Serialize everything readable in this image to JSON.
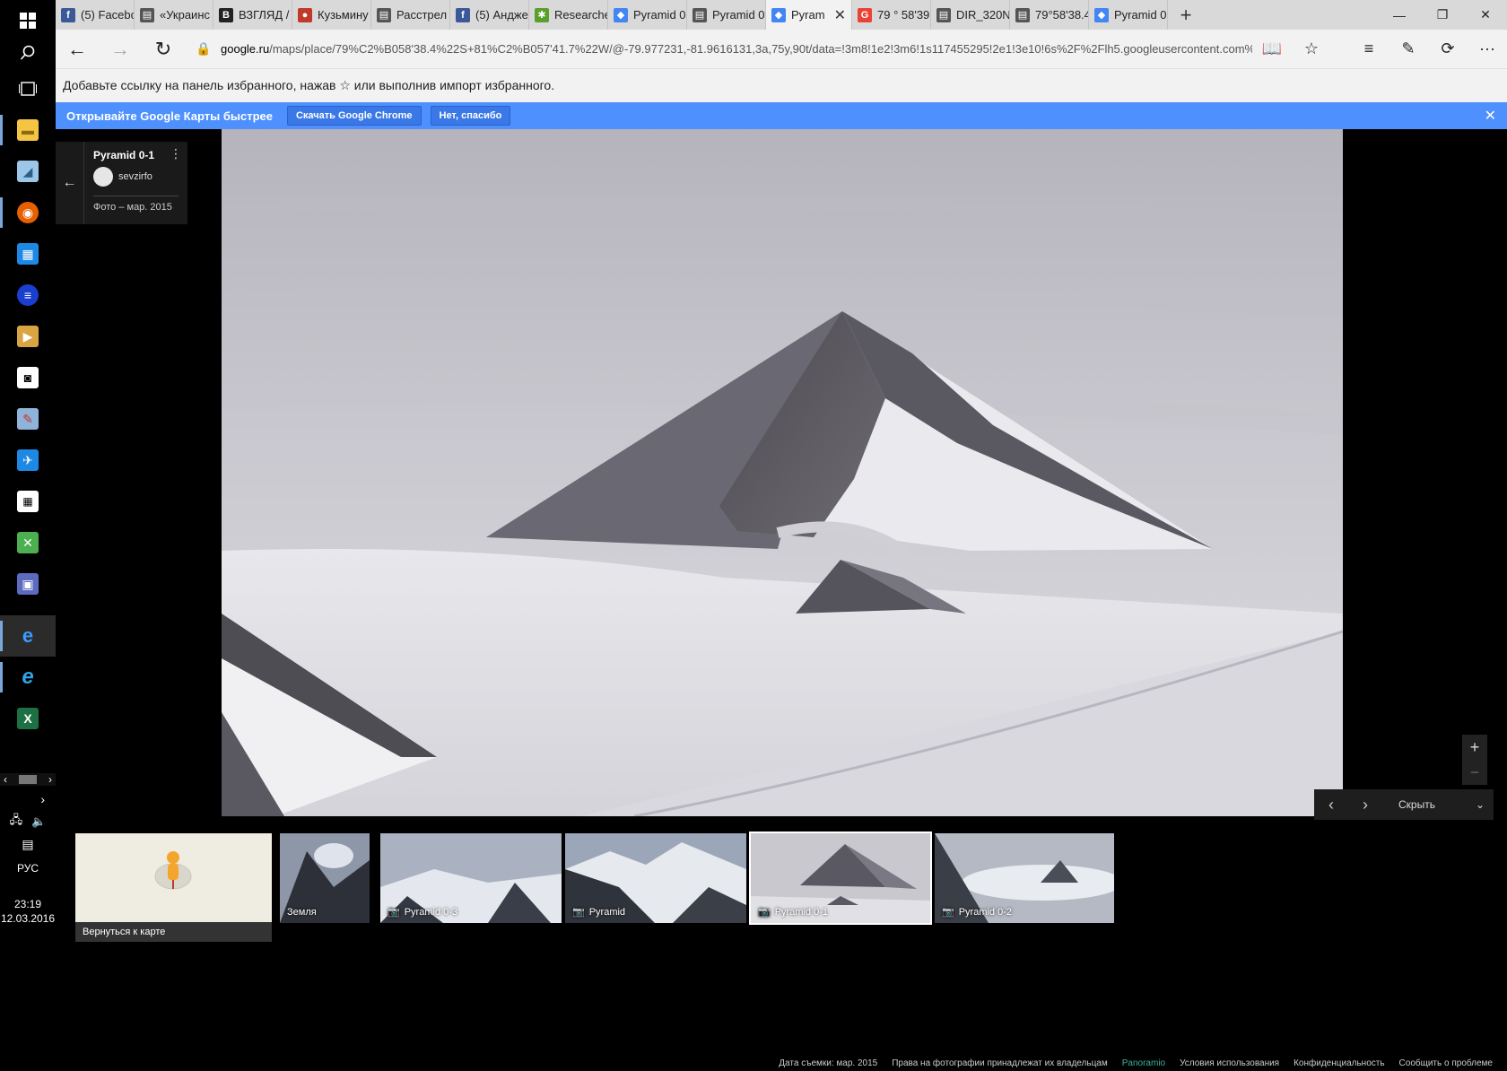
{
  "taskbar": {
    "lang": "РУС",
    "time": "23:19",
    "date": "12.03.2016"
  },
  "tabs": [
    {
      "label": "(5) Facebo",
      "icon": "facebook-icon",
      "color": "#3b5998",
      "glyph": "f"
    },
    {
      "label": "«Украинс",
      "icon": "page-icon",
      "color": "#555555",
      "glyph": "▤"
    },
    {
      "label": "ВЗГЛЯД /",
      "icon": "vzglyad-icon",
      "color": "#222222",
      "glyph": "B"
    },
    {
      "label": "Кузьмину",
      "icon": "site-icon",
      "color": "#c0392b",
      "glyph": "●"
    },
    {
      "label": "Расстрел ц",
      "icon": "page-icon",
      "color": "#555555",
      "glyph": "▤"
    },
    {
      "label": "(5) Андже",
      "icon": "facebook-icon",
      "color": "#3b5998",
      "glyph": "f"
    },
    {
      "label": "Researche",
      "icon": "research-icon",
      "color": "#5aa02c",
      "glyph": "✱"
    },
    {
      "label": "Pyramid 0",
      "icon": "maps-icon",
      "color": "#4285f4",
      "glyph": "◆"
    },
    {
      "label": "Pyramid 0-",
      "icon": "page-icon",
      "color": "#555555",
      "glyph": "▤"
    },
    {
      "label": "Pyram",
      "icon": "maps-icon",
      "color": "#4285f4",
      "glyph": "◆",
      "active": true
    },
    {
      "label": "79 ° 58'39",
      "icon": "google-icon",
      "color": "#ea4335",
      "glyph": "G"
    },
    {
      "label": "DIR_320NF",
      "icon": "page-icon",
      "color": "#555555",
      "glyph": "▤"
    },
    {
      "label": "79°58'38.4",
      "icon": "page-icon",
      "color": "#555555",
      "glyph": "▤"
    },
    {
      "label": "Pyramid 0-",
      "icon": "maps-icon",
      "color": "#4285f4",
      "glyph": "◆"
    }
  ],
  "address": {
    "domain": "google.ru",
    "path": "/maps/place/79%C2%B058'38.4%22S+81%C2%B057'41.7%22W/@-79.977231,-81.9616131,3a,75y,90t/data=!3m8!1e2!3m6!1s117455295!2e1!3e10!6s%2F%2Flh5.googleusercontent.com%2F"
  },
  "favorites_hint": "Добавьте ссылку на панель избранного, нажав ☆ или выполнив импорт избранного.",
  "promo": {
    "text": "Открывайте Google Карты быстрее",
    "download": "Скачать Google Chrome",
    "decline": "Нет, спасибо"
  },
  "photo_info": {
    "title": "Pyramid 0-1",
    "user": "sevzirfo",
    "date": "Фото – мар. 2015"
  },
  "strip": {
    "hide": "Скрыть"
  },
  "filmstrip": {
    "back_to_map": "Вернуться к карте",
    "items": [
      {
        "label": "Земля",
        "camera": false
      },
      {
        "label": "Pyramid 0-3",
        "camera": true
      },
      {
        "label": "Pyramid",
        "camera": true
      },
      {
        "label": "Pyramid 0-1",
        "camera": true,
        "selected": true
      },
      {
        "label": "Pyramid 0-2",
        "camera": true
      }
    ]
  },
  "footer": {
    "date": "Дата съемки: мар. 2015",
    "rights": "Права на фотографии принадлежат их владельцам",
    "panoramio": "Panoramio",
    "terms": "Условия использования",
    "privacy": "Конфиденциальность",
    "report": "Сообщить о проблеме"
  }
}
